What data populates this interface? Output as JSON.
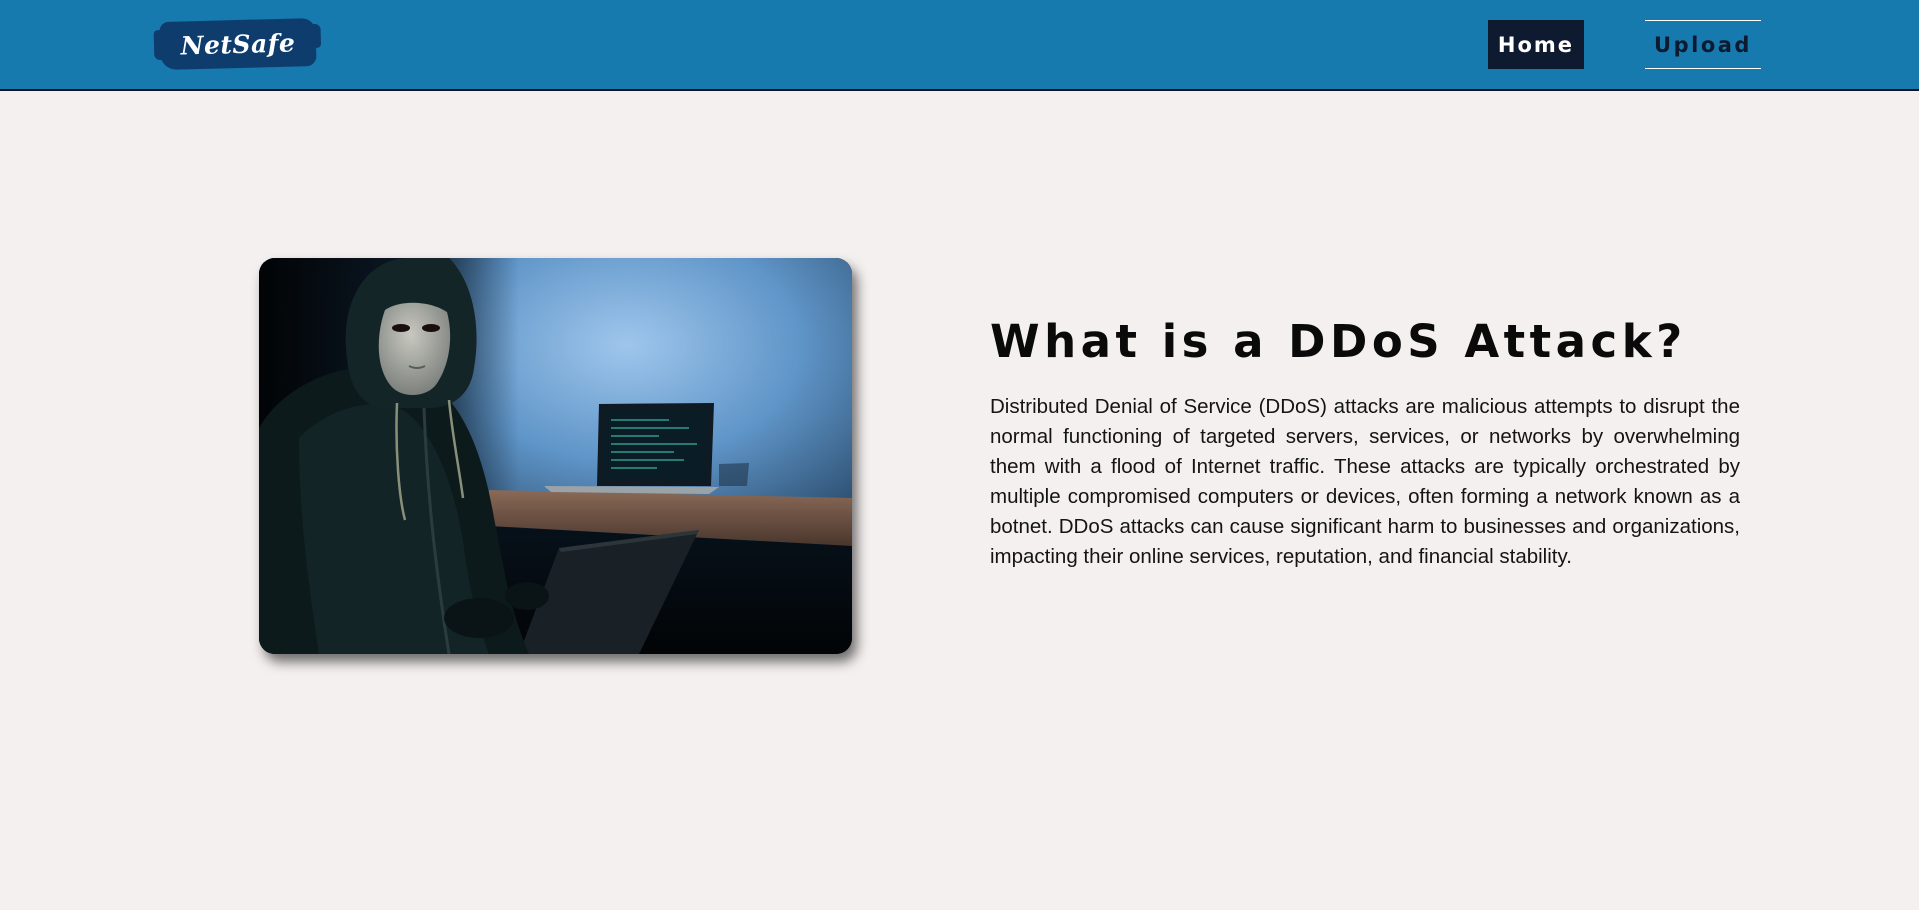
{
  "navbar": {
    "logo_text": "NetSafe",
    "links": {
      "home": "Home",
      "upload": "Upload"
    }
  },
  "main": {
    "image_icon": "hooded-hacker-photo",
    "title": "What is a DDoS Attack?",
    "body": "Distributed Denial of Service (DDoS) attacks are malicious attempts to disrupt the normal functioning of targeted servers, services, or networks by overwhelming them with a flood of Internet traffic. These attacks are typically orchestrated by multiple compromised computers or devices, often forming a network known as a botnet. DDoS attacks can cause significant harm to businesses and organizations, impacting their online services, reputation, and financial stability."
  },
  "colors": {
    "navbar_bg": "#177aaf",
    "logo_bg": "#0e3d6d",
    "active_link_bg": "#0d1a30",
    "page_bg": "#f4f0ef",
    "text": "#0a0a0a"
  }
}
